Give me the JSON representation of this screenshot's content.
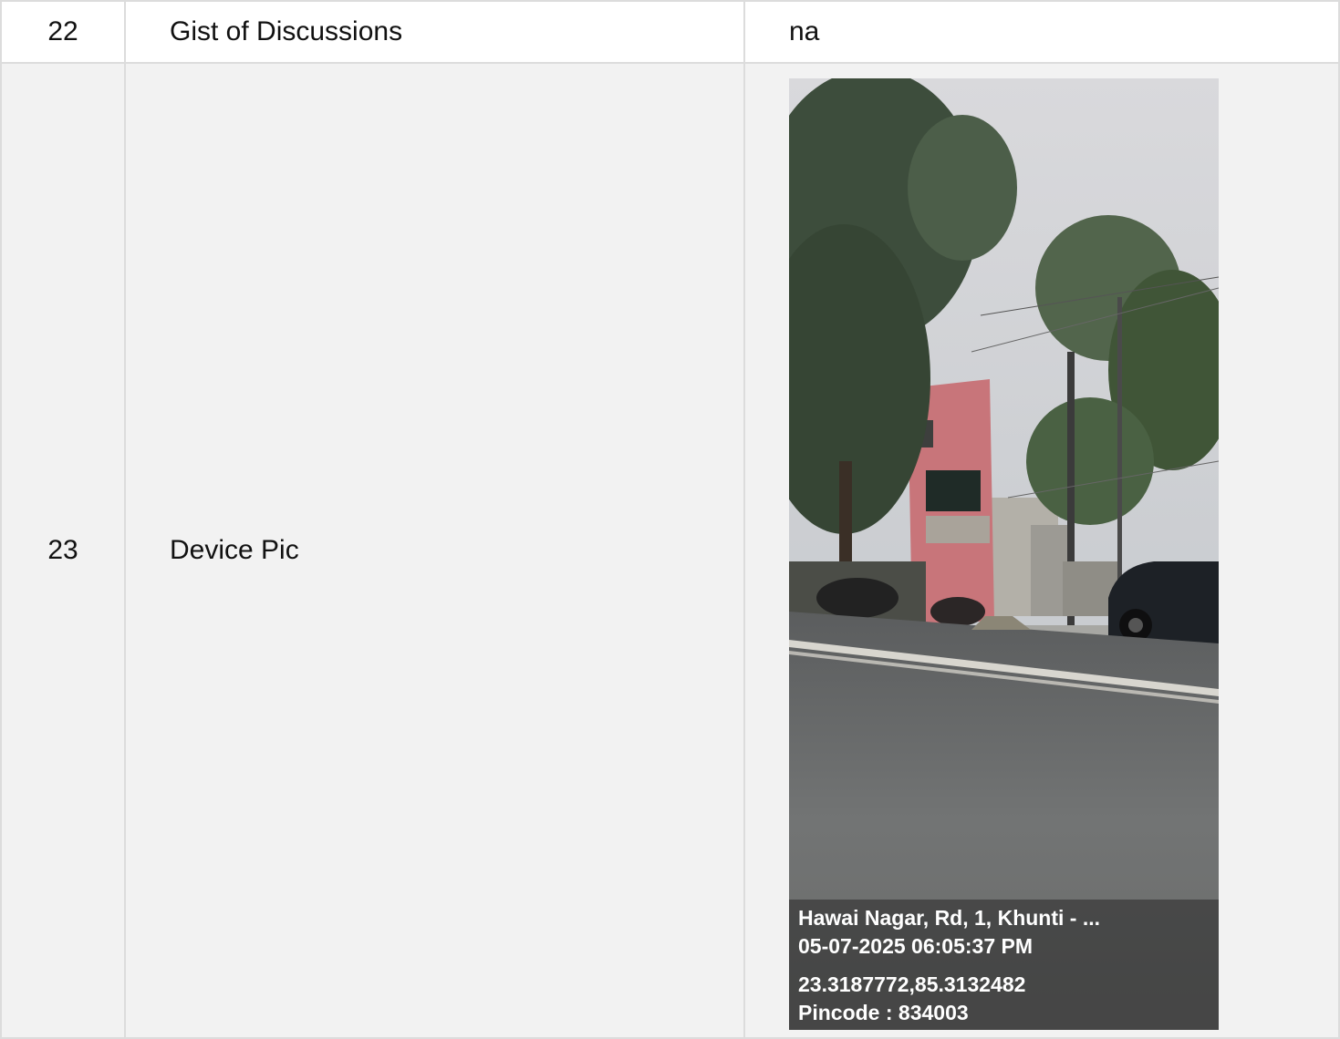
{
  "rows": [
    {
      "number": "22",
      "label": "Gist of Discussions",
      "value": "na"
    },
    {
      "number": "23",
      "label": "Device Pic",
      "photo": {
        "address": "Hawai Nagar, Rd, 1, Khunti - ...",
        "datetime": "05-07-2025 06:05:37 PM",
        "coordinates": "23.3187772,85.3132482",
        "pincode": "Pincode : 834003"
      }
    }
  ],
  "colors": {
    "border": "#dcdcdc",
    "row_alt": "#f2f2f2",
    "text": "#111111"
  }
}
